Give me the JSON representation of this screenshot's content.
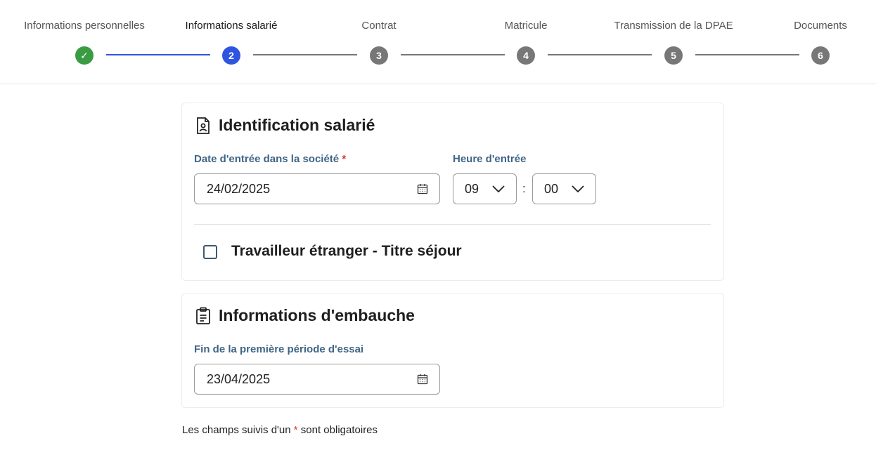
{
  "stepper": {
    "steps": [
      {
        "label": "Informations personnelles",
        "badge": "✓",
        "state": "done"
      },
      {
        "label": "Informations salarié",
        "badge": "2",
        "state": "active"
      },
      {
        "label": "Contrat",
        "badge": "3",
        "state": "todo"
      },
      {
        "label": "Matricule",
        "badge": "4",
        "state": "todo"
      },
      {
        "label": "Transmission de la DPAE",
        "badge": "5",
        "state": "todo"
      },
      {
        "label": "Documents",
        "badge": "6",
        "state": "todo"
      }
    ],
    "colors": {
      "done": "#3a9b43",
      "active": "#2f55e0",
      "todo": "#777777"
    }
  },
  "identification": {
    "icon": "id-badge-icon",
    "title": "Identification salarié",
    "entry_date_label": "Date d'entrée dans la société",
    "required_mark": "*",
    "entry_date_value": "24/02/2025",
    "entry_time_label": "Heure d'entrée",
    "hour_value": "09",
    "time_separator": ":",
    "minute_value": "00",
    "foreign_worker_label": "Travailleur étranger - Titre séjour",
    "foreign_worker_checked": false
  },
  "embauche": {
    "icon": "clipboard-icon",
    "title": "Informations d'embauche",
    "trial_end_label": "Fin de la première période d'essai",
    "trial_end_value": "23/04/2025"
  },
  "footnote": {
    "before": "Les champs suivis d'un ",
    "mark": "*",
    "after": " sont obligatoires"
  }
}
